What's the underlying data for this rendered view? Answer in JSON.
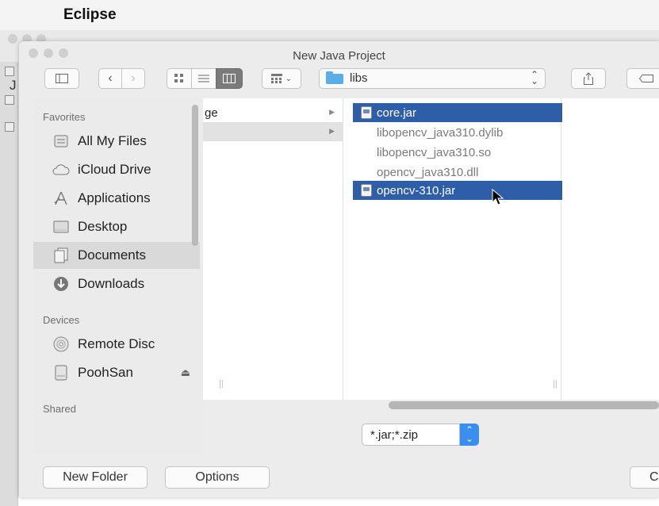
{
  "menubar": {
    "app_name": "Eclipse"
  },
  "background_window": {
    "label_fragment": "J"
  },
  "dialog": {
    "title": "New Java Project",
    "toolbar": {
      "path_folder": "libs"
    },
    "sidebar": {
      "sections": [
        {
          "heading": "Favorites",
          "items": [
            {
              "label": "All My Files",
              "icon": "all-files-icon"
            },
            {
              "label": "iCloud Drive",
              "icon": "cloud-icon"
            },
            {
              "label": "Applications",
              "icon": "applications-icon"
            },
            {
              "label": "Desktop",
              "icon": "desktop-icon"
            },
            {
              "label": "Documents",
              "icon": "documents-icon",
              "selected": true
            },
            {
              "label": "Downloads",
              "icon": "downloads-icon"
            }
          ]
        },
        {
          "heading": "Devices",
          "items": [
            {
              "label": "Remote Disc",
              "icon": "disc-icon"
            },
            {
              "label": "PoohSan",
              "icon": "hard-drive-icon"
            }
          ]
        },
        {
          "heading": "Shared",
          "items": []
        }
      ]
    },
    "column1": {
      "rows": [
        "ge",
        ""
      ]
    },
    "files": [
      {
        "name": "core.jar",
        "selected": true,
        "type": "jar"
      },
      {
        "name": "libopencv_java310.dylib",
        "selected": false,
        "type": "file"
      },
      {
        "name": "libopencv_java310.so",
        "selected": false,
        "type": "file"
      },
      {
        "name": "opencv_java310.dll",
        "selected": false,
        "type": "file"
      },
      {
        "name": "opencv-310.jar",
        "selected": true,
        "type": "jar"
      }
    ],
    "filter": {
      "value": "*.jar;*.zip"
    },
    "buttons": {
      "new_folder": "New Folder",
      "options": "Options",
      "cancel": "Ca"
    }
  },
  "colors": {
    "selection": "#2f5ea8",
    "accent": "#3a8ef0",
    "folder": "#5aaee8"
  }
}
